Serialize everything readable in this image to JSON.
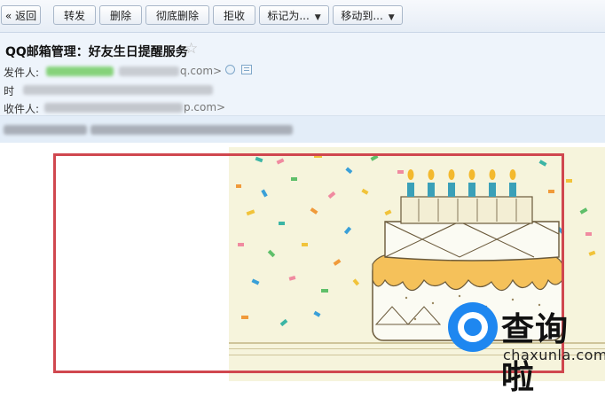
{
  "toolbar": {
    "back": "« 返回",
    "forward": "转发",
    "delete": "删除",
    "delete_permanent": "彻底删除",
    "reject": "拒收",
    "mark_as": "标记为...",
    "move_to": "移动到..."
  },
  "email": {
    "subject": "QQ邮箱管理：好友生日提醒服务",
    "sender_label": "发件人:",
    "sender_tail": "q.com>",
    "time_label": "时",
    "recipient_label": "收件人:",
    "recipient_tail": "p.com>"
  },
  "watermark": {
    "title": "查询啦",
    "url": "chaxunla.com"
  },
  "colors": {
    "highlight_frame": "#d0474f",
    "card_background": "#f6f4dc",
    "watermark_blue": "#1e87f0"
  }
}
